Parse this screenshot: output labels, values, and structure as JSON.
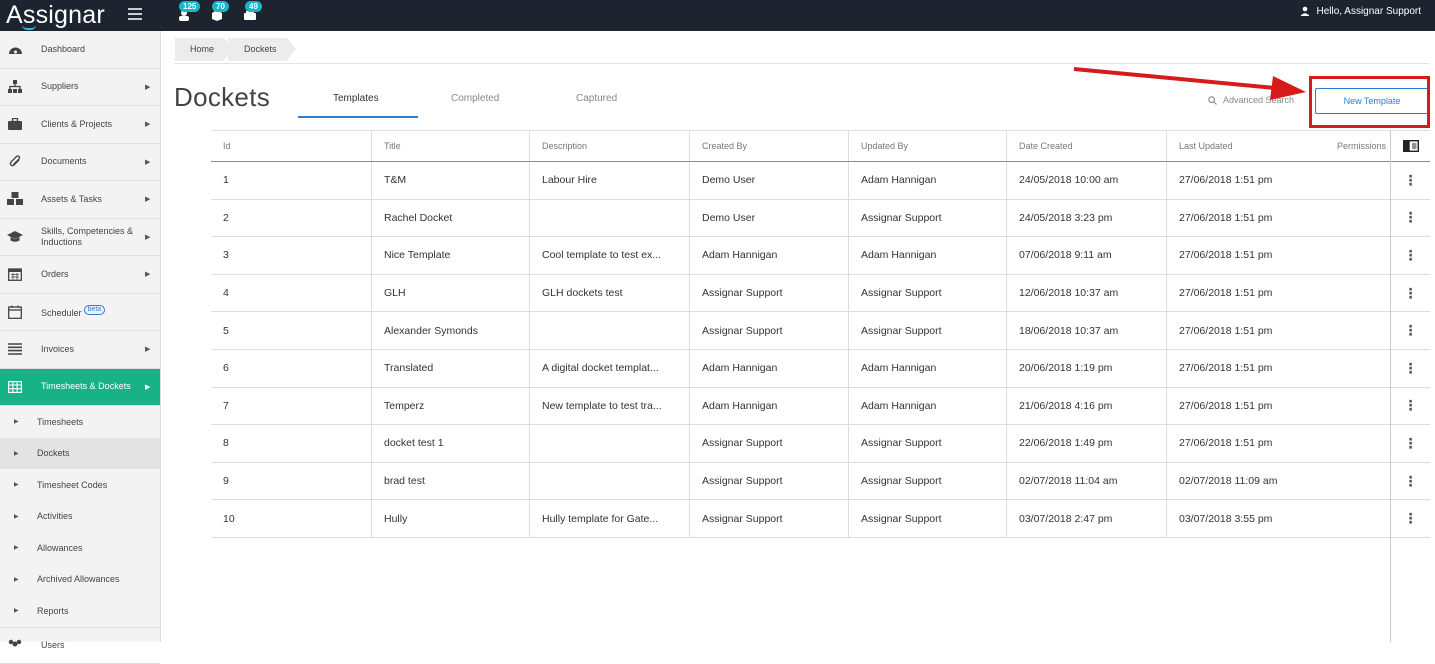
{
  "app": {
    "logo": "Assignar",
    "badges": [
      "125",
      "70",
      "49"
    ],
    "user_greeting": "Hello, Assignar Support"
  },
  "sidebar": {
    "items": [
      {
        "label": "Dashboard",
        "icon": "dashboard-icon",
        "arrow": false
      },
      {
        "label": "Suppliers",
        "icon": "sitemap-icon",
        "arrow": true
      },
      {
        "label": "Clients & Projects",
        "icon": "briefcase-icon",
        "arrow": true
      },
      {
        "label": "Documents",
        "icon": "paperclip-icon",
        "arrow": true
      },
      {
        "label": "Assets & Tasks",
        "icon": "cubes-icon",
        "arrow": true
      },
      {
        "label": "Skills, Competencies & Inductions",
        "icon": "graduation-cap-icon",
        "arrow": true
      },
      {
        "label": "Orders",
        "icon": "calendar-icon",
        "arrow": true
      },
      {
        "label": "Scheduler",
        "icon": "calendar-blank-icon",
        "arrow": false,
        "badge": "beta"
      },
      {
        "label": "Invoices",
        "icon": "list-icon",
        "arrow": true
      },
      {
        "label": "Timesheets & Dockets",
        "icon": "table-icon",
        "arrow": true,
        "active": true
      }
    ],
    "sub_items": [
      "Timesheets",
      "Dockets",
      "Timesheet Codes",
      "Activities",
      "Allowances",
      "Archived Allowances",
      "Reports"
    ],
    "last_item": "Users"
  },
  "breadcrumb": [
    "Home",
    "Dockets"
  ],
  "page": {
    "title": "Dockets",
    "tabs": [
      "Templates",
      "Completed",
      "Captured"
    ],
    "active_tab": "Templates",
    "advanced_search": "Advanced Search",
    "new_template": "New Template"
  },
  "table": {
    "columns": [
      "Id",
      "Title",
      "Description",
      "Created By",
      "Updated By",
      "Date Created",
      "Last Updated",
      "Permissions"
    ],
    "rows": [
      [
        "1",
        "T&M",
        "Labour Hire",
        "Demo User",
        "Adam Hannigan",
        "24/05/2018 10:00 am",
        "27/06/2018 1:51 pm"
      ],
      [
        "2",
        "Rachel Docket",
        "",
        "Demo User",
        "Assignar Support",
        "24/05/2018 3:23 pm",
        "27/06/2018 1:51 pm"
      ],
      [
        "3",
        "Nice Template",
        "Cool template to test ex...",
        "Adam Hannigan",
        "Adam Hannigan",
        "07/06/2018 9:11 am",
        "27/06/2018 1:51 pm"
      ],
      [
        "4",
        "GLH",
        "GLH dockets test",
        "Assignar Support",
        "Assignar Support",
        "12/06/2018 10:37 am",
        "27/06/2018 1:51 pm"
      ],
      [
        "5",
        "Alexander Symonds",
        "",
        "Assignar Support",
        "Assignar Support",
        "18/06/2018 10:37 am",
        "27/06/2018 1:51 pm"
      ],
      [
        "6",
        "Translated",
        "A digital docket templat...",
        "Adam Hannigan",
        "Adam Hannigan",
        "20/06/2018 1:19 pm",
        "27/06/2018 1:51 pm"
      ],
      [
        "7",
        "Temperz",
        "New template to test tra...",
        "Adam Hannigan",
        "Adam Hannigan",
        "21/06/2018 4:16 pm",
        "27/06/2018 1:51 pm"
      ],
      [
        "8",
        "docket test 1",
        "",
        "Assignar Support",
        "Assignar Support",
        "22/06/2018 1:49 pm",
        "27/06/2018 1:51 pm"
      ],
      [
        "9",
        "brad test",
        "",
        "Assignar Support",
        "Assignar Support",
        "02/07/2018 11:04 am",
        "02/07/2018 11:09 am"
      ],
      [
        "10",
        "Hully",
        "Hully template for Gate...",
        "Assignar Support",
        "Assignar Support",
        "03/07/2018 2:47 pm",
        "03/07/2018 3:55 pm"
      ]
    ]
  },
  "colors": {
    "topbar": "#1e2330",
    "accent": "#2a7fd4",
    "active_nav": "#17b285",
    "badge": "#13b9c9",
    "annotation": "#d71a1a"
  }
}
